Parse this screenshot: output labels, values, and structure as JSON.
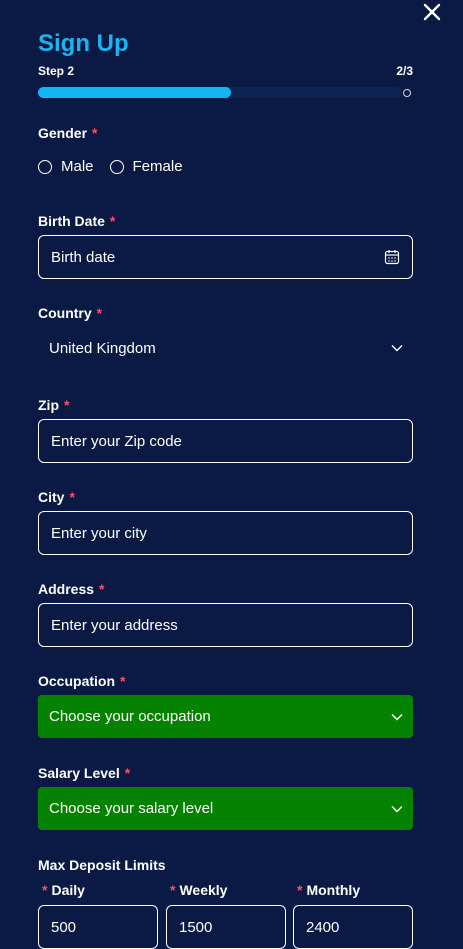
{
  "header": {
    "title": "Sign Up",
    "step_label": "Step 2",
    "step_count": "2/3",
    "progress": 0.53
  },
  "colors": {
    "background": "#0a1a44",
    "accent": "#1bb4f0",
    "progress": "#12b6f5",
    "required_star": "#ff4d6d",
    "select_green": "#058200"
  },
  "icons": {
    "close": "close-icon",
    "calendar": "calendar-icon",
    "chevron": "chevron-down-icon"
  },
  "required_mark": "*",
  "gender": {
    "label": "Gender",
    "options": [
      "Male",
      "Female"
    ]
  },
  "birth_date": {
    "label": "Birth Date",
    "placeholder": "Birth date"
  },
  "country": {
    "label": "Country",
    "value": "United Kingdom"
  },
  "zip": {
    "label": "Zip",
    "placeholder": "Enter your Zip code"
  },
  "city": {
    "label": "City",
    "placeholder": "Enter your city"
  },
  "address": {
    "label": "Address",
    "placeholder": "Enter your address"
  },
  "occupation": {
    "label": "Occupation",
    "value": "Choose your occupation"
  },
  "salary": {
    "label": "Salary Level",
    "value": "Choose your salary level"
  },
  "limits": {
    "title": "Max Deposit Limits",
    "daily": {
      "label": "Daily",
      "value": "500"
    },
    "weekly": {
      "label": "Weekly",
      "value": "1500"
    },
    "monthly": {
      "label": "Monthly",
      "value": "2400"
    }
  }
}
